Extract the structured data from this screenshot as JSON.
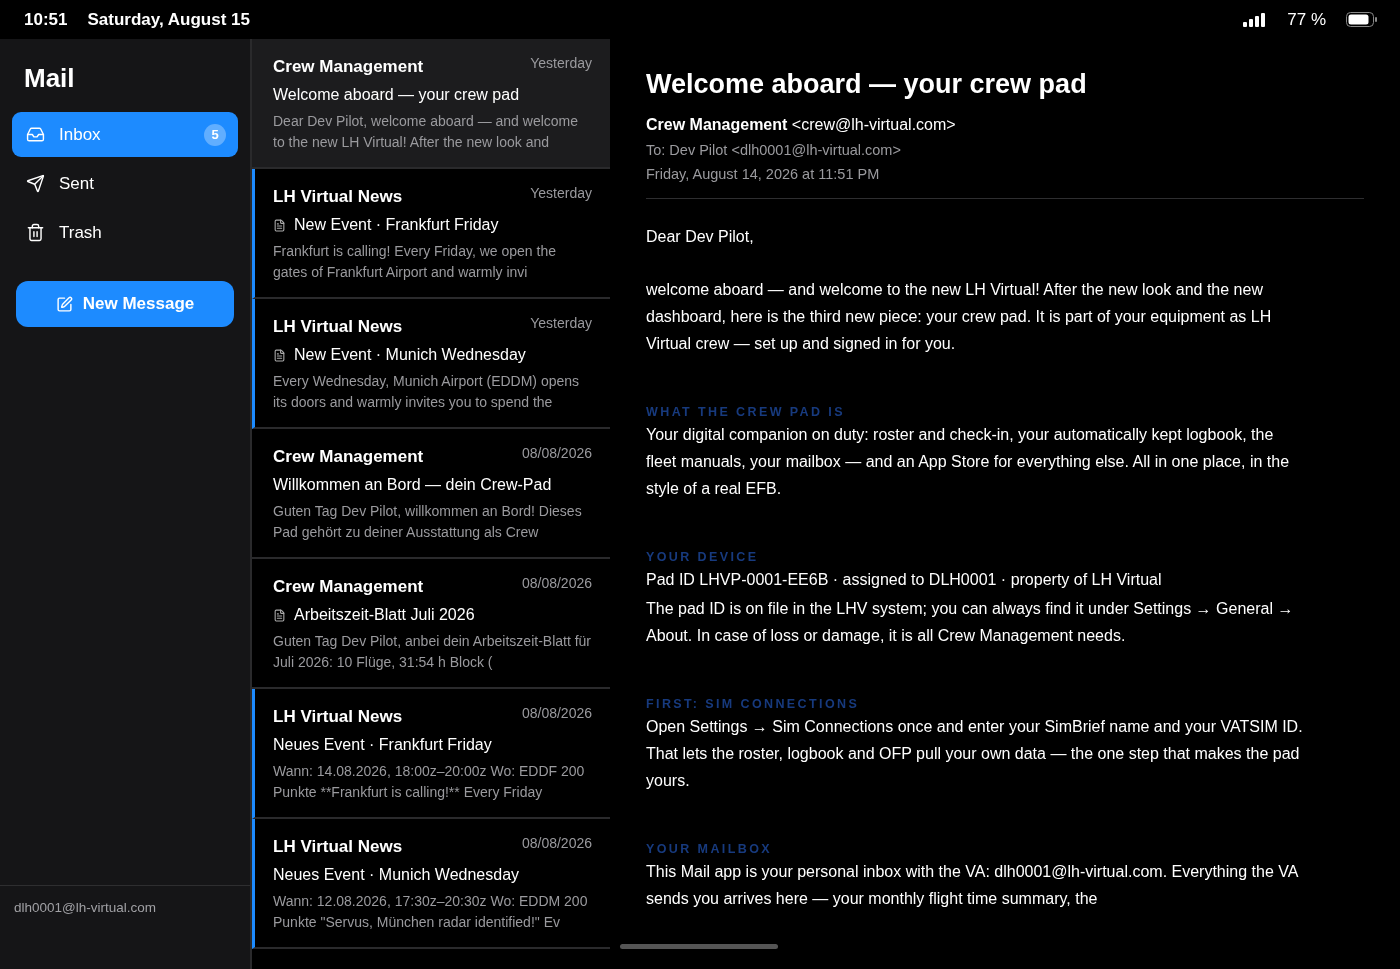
{
  "status_bar": {
    "time": "10:51",
    "date": "Saturday, August 15",
    "battery": "77 %"
  },
  "sidebar": {
    "title": "Mail",
    "items": [
      {
        "label": "Inbox",
        "kind": "inbox",
        "selected": true,
        "count": "5"
      },
      {
        "label": "Sent",
        "kind": "sent",
        "selected": false
      },
      {
        "label": "Trash",
        "kind": "trash",
        "selected": false
      }
    ],
    "new_message": "New Message",
    "account": "dlh0001@lh-virtual.com"
  },
  "messages": [
    {
      "sender": "Crew Management",
      "date": "Yesterday",
      "subject": "Welcome aboard — your crew pad",
      "preview": "Dear Dev Pilot, welcome aboard — and welcome to the new LH Virtual! After the new look and",
      "selected": true,
      "unread": false,
      "document": false
    },
    {
      "sender": "LH Virtual News",
      "date": "Yesterday",
      "subject": "New Event · Frankfurt Friday",
      "preview": "Frankfurt is calling! Every Friday, we open the gates of Frankfurt Airport and warmly invi",
      "selected": false,
      "unread": true,
      "document": true
    },
    {
      "sender": "LH Virtual News",
      "date": "Yesterday",
      "subject": "New Event · Munich Wednesday",
      "preview": "Every Wednesday, Munich Airport (EDDM) opens its doors and warmly invites you to spend the",
      "selected": false,
      "unread": true,
      "document": true
    },
    {
      "sender": "Crew Management",
      "date": "08/08/2026",
      "subject": "Willkommen an Bord — dein Crew-Pad",
      "preview": "Guten Tag Dev Pilot, willkommen an Bord! Dieses Pad gehört zu deiner Ausstattung als Crew",
      "selected": false,
      "unread": false,
      "document": false
    },
    {
      "sender": "Crew Management",
      "date": "08/08/2026",
      "subject": "Arbeitszeit-Blatt Juli 2026",
      "preview": "Guten Tag Dev Pilot, anbei dein Arbeitszeit-Blatt für Juli 2026: 10 Flüge, 31:54 h Block (",
      "selected": false,
      "unread": false,
      "document": true
    },
    {
      "sender": "LH Virtual News",
      "date": "08/08/2026",
      "subject": "Neues Event · Frankfurt Friday",
      "preview": "Wann: 14.08.2026, 18:00z–20:00z Wo: EDDF 200 Punkte **Frankfurt is calling!** Every Friday",
      "selected": false,
      "unread": true,
      "document": false
    },
    {
      "sender": "LH Virtual News",
      "date": "08/08/2026",
      "subject": "Neues Event · Munich Wednesday",
      "preview": "Wann: 12.08.2026, 17:30z–20:30z Wo: EDDM 200 Punkte \"Servus, München radar identified!\" Ev",
      "selected": false,
      "unread": true,
      "document": false
    }
  ],
  "reader": {
    "subject": "Welcome aboard — your crew pad",
    "sender_name": "Crew Management",
    "sender_address": "<crew@lh-virtual.com>",
    "to": "To: Dev Pilot <dlh0001@lh-virtual.com>",
    "date": "Friday, August 14, 2026 at 11:51 PM",
    "greeting": "Dear Dev Pilot,",
    "intro": "welcome aboard — and welcome to the new LH Virtual! After the new look and the new dashboard, here is the third new piece: your crew pad. It is part of your equipment as LH Virtual crew — set up and signed in for you.",
    "sections": [
      {
        "heading": "WHAT THE CREW PAD IS",
        "paragraphs": [
          "Your digital companion on duty: roster and check-in, your automatically kept logbook, the fleet manuals, your mailbox — and an App Store for everything else. All in one place, in the style of a real EFB."
        ]
      },
      {
        "heading": "YOUR DEVICE",
        "paragraphs": [
          "Pad ID LHVP-0001-EE6B · assigned to DLH0001 · property of LH Virtual",
          "The pad ID is on file in the LHV system; you can always find it under Settings → General → About. In case of loss or damage, it is all Crew Management needs."
        ]
      },
      {
        "heading": "FIRST: SIM CONNECTIONS",
        "paragraphs": [
          "Open Settings → Sim Connections once and enter your SimBrief name and your VATSIM ID. That lets the roster, logbook and OFP pull your own data — the one step that makes the pad yours."
        ]
      },
      {
        "heading": "YOUR MAILBOX",
        "paragraphs": [
          "This Mail app is your personal inbox with the VA: dlh0001@lh-virtual.com. Everything the VA sends you arrives here — your monthly flight time summary, the"
        ]
      }
    ]
  }
}
